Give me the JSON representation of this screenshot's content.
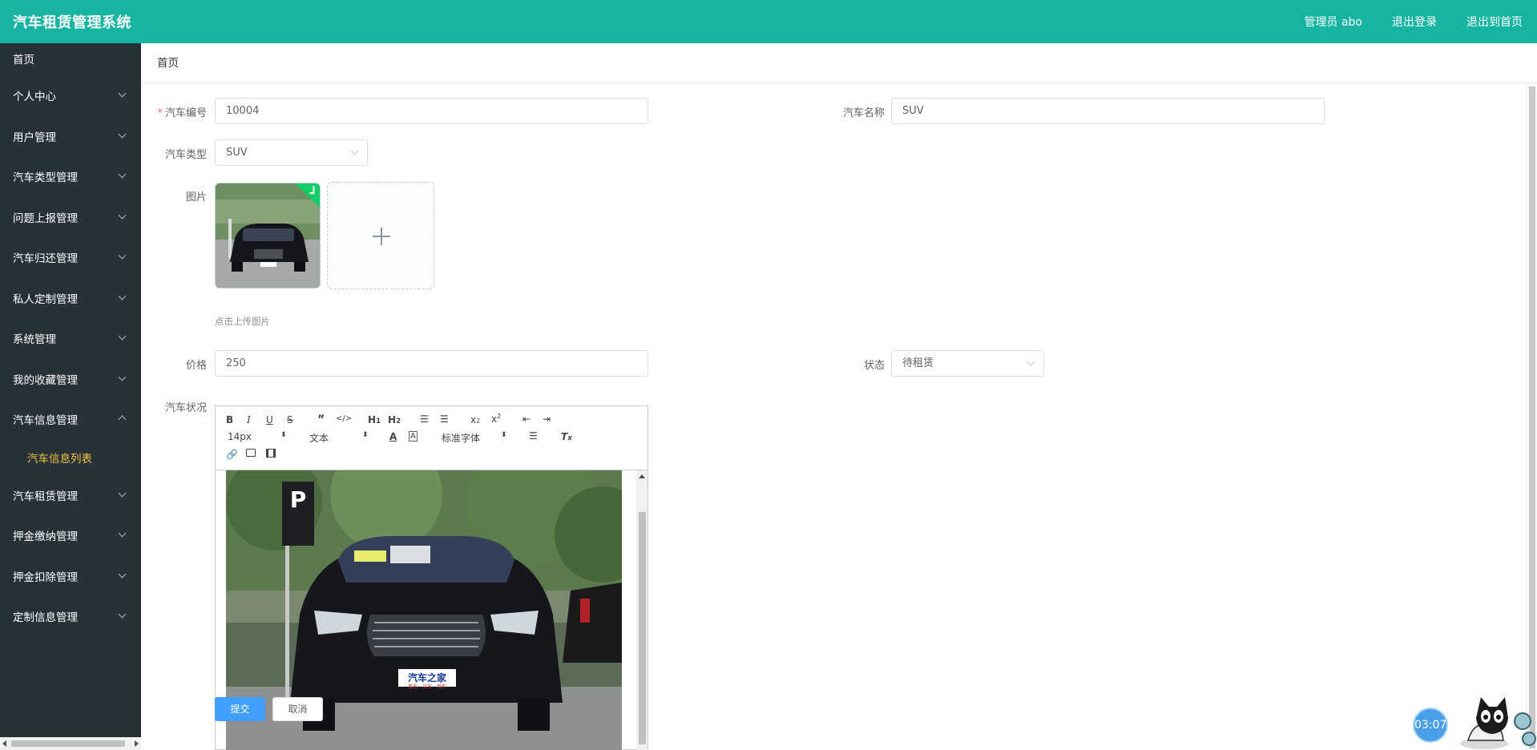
{
  "header": {
    "title": "汽车租赁管理系统",
    "admin_label": "管理员 abo",
    "logout_label": "退出登录",
    "back_home_label": "退出到首页"
  },
  "sidebar": {
    "home": "首页",
    "items": [
      {
        "label": "个人中心"
      },
      {
        "label": "用户管理"
      },
      {
        "label": "汽车类型管理"
      },
      {
        "label": "问题上报管理"
      },
      {
        "label": "汽车归还管理"
      },
      {
        "label": "私人定制管理"
      },
      {
        "label": "系统管理"
      },
      {
        "label": "我的收藏管理"
      },
      {
        "label": "汽车信息管理"
      }
    ],
    "sub_item": "汽车信息列表",
    "items_after": [
      {
        "label": "汽车租赁管理"
      },
      {
        "label": "押金缴纳管理"
      },
      {
        "label": "押金扣除管理"
      },
      {
        "label": "定制信息管理"
      }
    ]
  },
  "breadcrumb": "首页",
  "form": {
    "car_no_label": "汽车编号",
    "car_no_value": "10004",
    "car_name_label": "汽车名称",
    "car_name_value": "SUV",
    "car_type_label": "汽车类型",
    "car_type_value": "SUV",
    "image_label": "图片",
    "upload_tip": "点击上传图片",
    "price_label": "价格",
    "price_value": "250",
    "status_label": "状态",
    "status_value": "待租赁",
    "condition_label": "汽车状况"
  },
  "editor": {
    "font_size": "14px",
    "header_select": "文本",
    "font_family": "标准字体",
    "plate_text": "汽车之家",
    "plate_sub": "看车 · 买车 · 用车",
    "parking_sign": "P"
  },
  "buttons": {
    "submit": "提交",
    "cancel": "取消"
  },
  "timer": "03:07"
}
